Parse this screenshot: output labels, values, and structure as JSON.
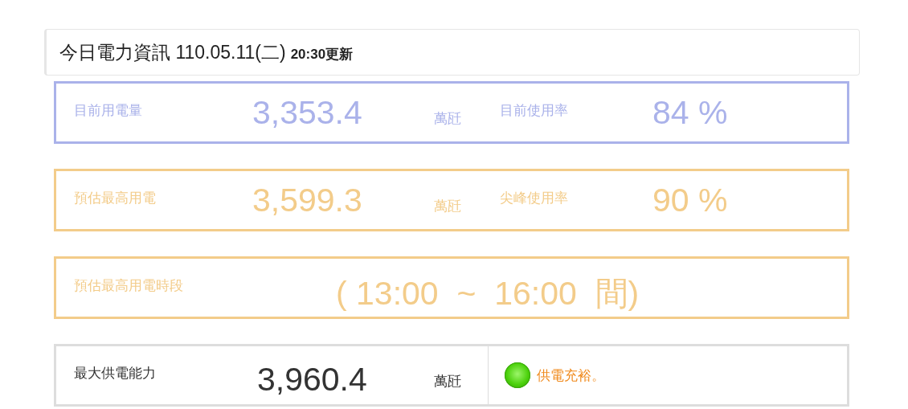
{
  "header": {
    "title": "今日電力資訊 110.05.11(二)",
    "updated": "20:30更新"
  },
  "cards": [
    {
      "kind": "metric",
      "color": "#aab2ea",
      "label": "目前用電量",
      "value": "3,353.4",
      "unit": "萬瓩",
      "rate_label": "目前使用率",
      "rate": "84 %"
    },
    {
      "kind": "metric",
      "color": "#f3cc8a",
      "label": "預估最高用電",
      "value": "3,599.3",
      "unit": "萬瓩",
      "rate_label": "尖峰使用率",
      "rate": "90 %"
    },
    {
      "kind": "period",
      "color": "#f3cc8a",
      "label": "預估最高用電時段",
      "value": "( 13:00  ~  16:00  間)"
    },
    {
      "kind": "supply",
      "color": "#dddddd",
      "label": "最大供電能力",
      "value": "3,960.4",
      "unit": "萬瓩",
      "status": {
        "color": "#4cd10c",
        "text": "供電充裕。"
      }
    }
  ]
}
